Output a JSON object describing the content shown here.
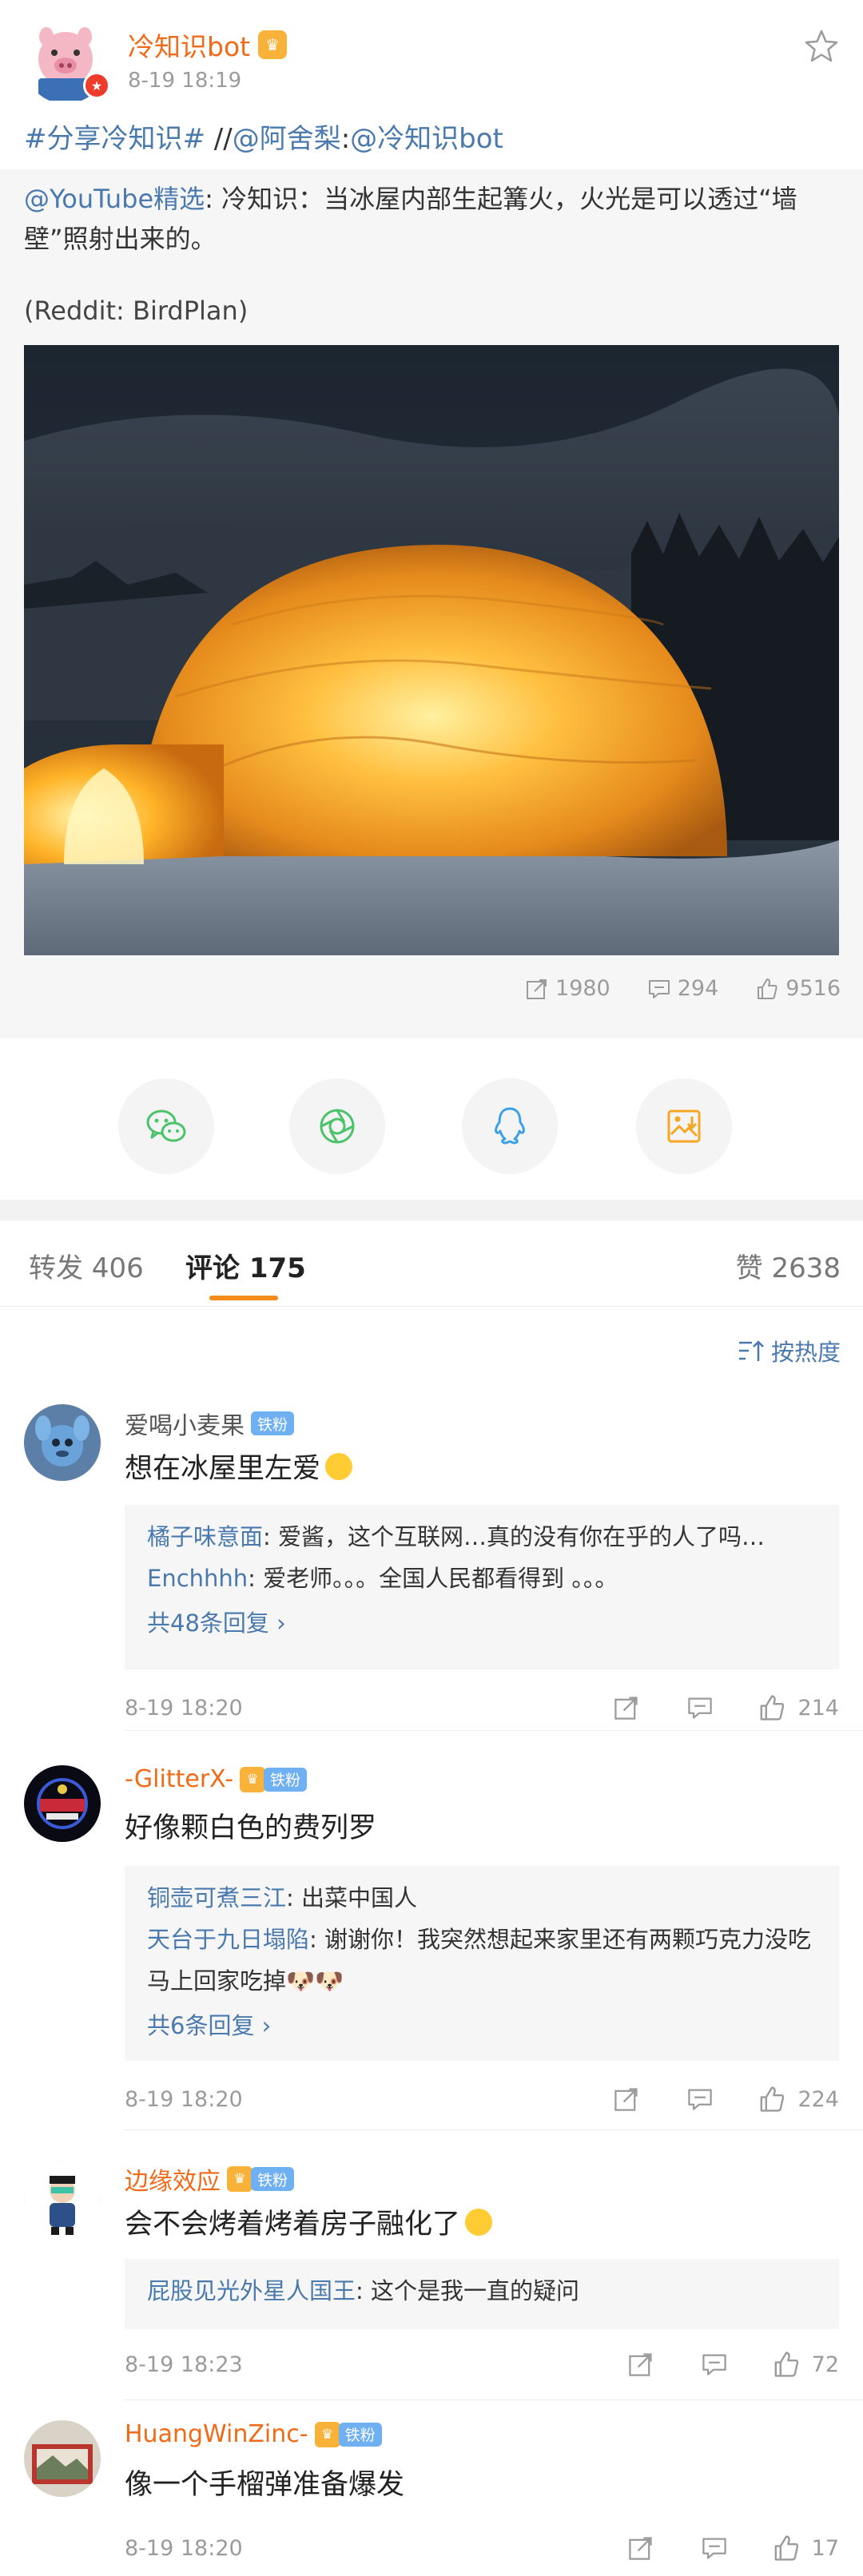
{
  "post": {
    "author": "冷知识bot",
    "time": "8-19 18:19",
    "hashtag": "#分享冷知识#",
    "separator": " //",
    "mention": "@阿舍梨",
    "colon": ":",
    "repost_of": "@冷知识bot",
    "repost": {
      "author": "@YouTube精选",
      "text": ": 冷知识：当冰屋内部生起篝火，火光是可以透过“墙壁”照射出来的。",
      "source": "(Reddit: BirdPlan)",
      "stats": {
        "reposts": "1980",
        "comments": "294",
        "likes": "9516"
      }
    }
  },
  "share": [
    {
      "icon": "wechat-icon"
    },
    {
      "icon": "moments-icon"
    },
    {
      "icon": "qq-icon"
    },
    {
      "icon": "save-image-icon"
    }
  ],
  "tabs": {
    "repost": "转发 406",
    "comment": "评论 175",
    "like": "赞 2638"
  },
  "sort_label": "按热度",
  "comments": [
    {
      "user": "爱喝小麦果",
      "badge": "铁粉",
      "text": "想在冰屋里左爱",
      "replies": [
        {
          "user": "橘子味意面",
          "text": ": 爱酱，这个互联网…真的没有你在乎的人了吗…"
        },
        {
          "user": "Enchhhh",
          "text": ": 爱老师。。。全国人民都看得到 。。。"
        }
      ],
      "more": "共48条回复",
      "time": "8-19 18:20",
      "likes": "214"
    },
    {
      "user": "-GlitterX-",
      "badge": "铁粉",
      "text": "好像颗白色的费列罗",
      "replies": [
        {
          "user": "铜壶可煮三江",
          "text": ": 出菜中国人"
        },
        {
          "user": "天台于九日塌陷",
          "text": ": 谢谢你！我突然想起来家里还有两颗巧克力没吃 马上回家吃掉🐶🐶"
        }
      ],
      "more": "共6条回复",
      "time": "8-19 18:20",
      "likes": "224"
    },
    {
      "user": "边缘效应",
      "badge": "铁粉",
      "text": "会不会烤着烤着房子融化了",
      "replies": [
        {
          "user": "屁股见光外星人国王",
          "text": ": 这个是我一直的疑问"
        }
      ],
      "time": "8-19 18:23",
      "likes": "72"
    },
    {
      "user": "HuangWinZinc-",
      "badge": "铁粉",
      "text": "像一个手榴弹准备爆发",
      "time": "8-19 18:20",
      "likes": "17"
    }
  ],
  "colors": {
    "accent_orange": "#f26a17",
    "link_blue": "#4a79ad",
    "tab_underline": "#f58b1b",
    "fan_badge": "#6fb0f3"
  }
}
